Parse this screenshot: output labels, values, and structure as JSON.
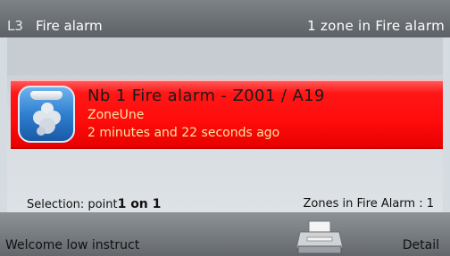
{
  "header": {
    "level": "L3",
    "title": "Fire alarm",
    "summary": "1 zone in Fire alarm"
  },
  "alarm": {
    "icon": "smoke-detector-icon",
    "title": "Nb 1 Fire alarm - Z001 / A19",
    "zone": "ZoneUne",
    "time": "2 minutes and 22 seconds ago",
    "colors": {
      "row": "#ff0c0c",
      "subtext": "#ffe3a0"
    }
  },
  "status": {
    "selection_prefix": "Selection: point",
    "selection_count": "1 on 1",
    "zones_label": "Zones in Fire Alarm : 1"
  },
  "footer": {
    "welcome": "Welcome  low instruct",
    "printer_icon": "printer-icon",
    "detail": "Detail"
  }
}
